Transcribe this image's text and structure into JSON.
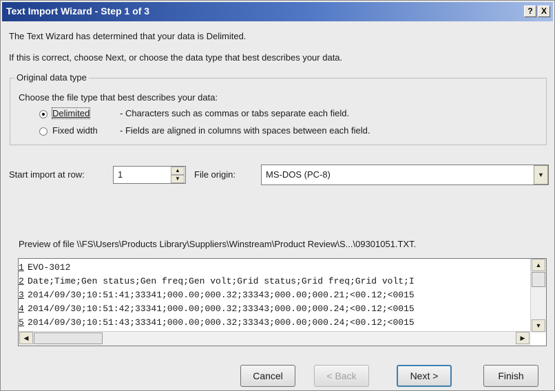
{
  "window": {
    "title": "Text Import Wizard - Step 1 of 3",
    "help_button": "?",
    "close_button": "X"
  },
  "intro": {
    "line1": "The Text Wizard has determined that your data is Delimited.",
    "line2": "If this is correct, choose Next, or choose the data type that best describes your data."
  },
  "original_data_type": {
    "legend": "Original data type",
    "prompt": "Choose the file type that best describes your data:",
    "options": [
      {
        "label": "Delimited",
        "description": "- Characters such as commas or tabs separate each field.",
        "selected": true
      },
      {
        "label": "Fixed width",
        "description": "- Fields are aligned in columns with spaces between each field.",
        "selected": false
      }
    ]
  },
  "start_row": {
    "label": "Start import at row:",
    "value": "1"
  },
  "file_origin": {
    "label": "File origin:",
    "value": "MS-DOS (PC-8)"
  },
  "preview": {
    "label": "Preview of file \\\\FS\\Users\\Products Library\\Suppliers\\Winstream\\Product Review\\S...\\09301051.TXT.",
    "rows": [
      {
        "num": "1",
        "text": "EVO-3012"
      },
      {
        "num": "2",
        "text": "Date;Time;Gen status;Gen freq;Gen volt;Grid status;Grid freq;Grid volt;I"
      },
      {
        "num": "3",
        "text": "2014/09/30;10:51:41;33341;000.00;000.32;33343;000.00;000.21;<00.12;<0015"
      },
      {
        "num": "4",
        "text": "2014/09/30;10:51:42;33341;000.00;000.32;33343;000.00;000.24;<00.12;<0015"
      },
      {
        "num": "5",
        "text": "2014/09/30;10:51:43;33341;000.00;000.32;33343;000.00;000.24;<00.12;<0015"
      }
    ]
  },
  "buttons": {
    "cancel": "Cancel",
    "back": "< Back",
    "next": "Next >",
    "finish": "Finish"
  },
  "icons": {
    "spin_up": "▲",
    "spin_down": "▼",
    "dropdown": "▼",
    "scroll_up": "▲",
    "scroll_down": "▼",
    "scroll_left": "◀",
    "scroll_right": "▶"
  }
}
